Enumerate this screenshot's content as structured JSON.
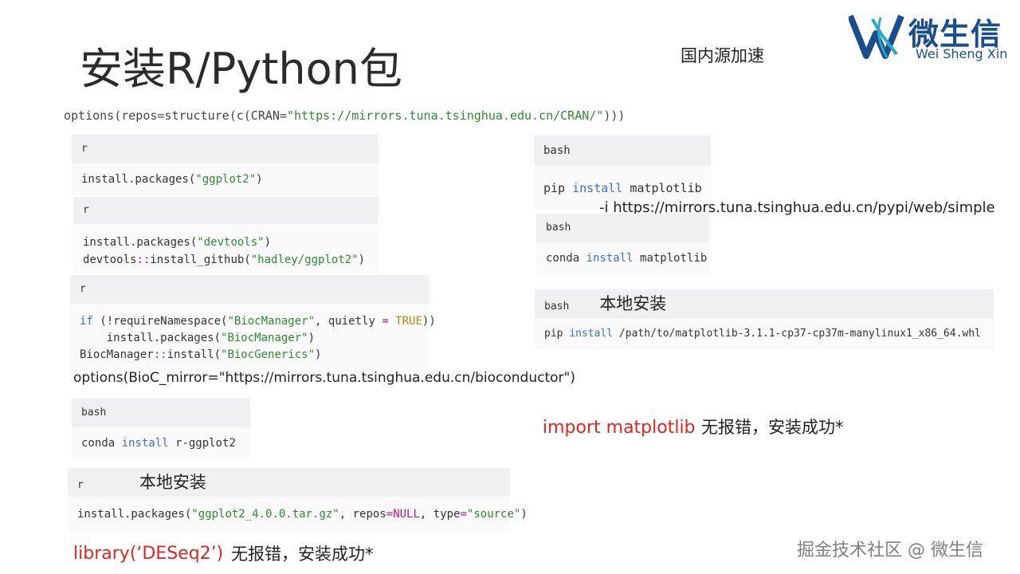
{
  "slide": {
    "title": "安装R/Python包",
    "subtitle": "国内源加速",
    "logo": {
      "zh": "微生信",
      "en": "Wei Sheng Xin"
    },
    "cran_option": {
      "prefix": "options(repos=structure(c(CRAN=",
      "url": "\"https://mirrors.tuna.tsinghua.edu.cn/CRAN/\"",
      "suffix": ")))"
    },
    "blocks": {
      "r1": {
        "lang": "r",
        "fn": "install.packages(",
        "arg": "\"ggplot2\"",
        "end": ")"
      },
      "r2": {
        "lang": "r",
        "l1_fn": "install.packages(",
        "l1_arg": "\"devtools\"",
        "l1_end": ")",
        "l2_fn": "devtools",
        "l2_ns": "::",
        "l2_fn2": "install_github(",
        "l2_arg": "\"hadley/ggplot2\"",
        "l2_end": ")"
      },
      "r3": {
        "lang": "r",
        "l1_kw": "if",
        "l1_a": " (!requireNamespace(",
        "l1_s": "\"BiocManager\"",
        "l1_b": ", quietly ",
        "l1_eq": "=",
        "l1_t": " TRUE",
        "l1_c": "))",
        "l2_a": "    install.packages(",
        "l2_s": "\"BiocManager\"",
        "l2_c": ")",
        "l3_a": "BiocManager",
        "l3_ns": "::",
        "l3_b": "install(",
        "l3_s": "\"BiocGenerics\"",
        "l3_c": ")"
      },
      "bioc_mirror": "options(BioC_mirror=\"https://mirrors.tuna.tsinghua.edu.cn/bioconductor\")",
      "bash_r": {
        "lang": "bash",
        "a": "conda ",
        "kw": "install",
        "b": " r-ggplot2"
      },
      "r_local": {
        "lang": "r",
        "label": "本地安装",
        "fn": "install.packages(",
        "s1": "\"ggplot2_4.0.0.tar.gz\"",
        "b": ", repos",
        "eq": "=",
        "null": "NULL",
        "c": ", type",
        "eq2": "=",
        "s2": "\"source\"",
        "end": ")"
      },
      "library_call": "library(‘DESeq2’)",
      "library_note": "无报错，安装成功*",
      "pip1": {
        "lang": "bash",
        "a": "pip ",
        "kw": "install",
        "b": " matplotlib"
      },
      "pip_mirror": "-i https://mirrors.tuna.tsinghua.edu.cn/pypi/web/simple",
      "conda_py": {
        "lang": "bash",
        "a": "conda ",
        "kw": "install",
        "b": " matplotlib"
      },
      "pip_local": {
        "lang": "bash",
        "label": "本地安装",
        "a": "pip ",
        "kw": "install",
        "b": " /path/to/matplotlib-3.1.1-cp37-cp37m-manylinux1_x86_64.whl"
      },
      "import_call": "import matplotlib",
      "import_note": "无报错，安装成功*"
    },
    "footer": "掘金技术社区 @ 微生信"
  }
}
